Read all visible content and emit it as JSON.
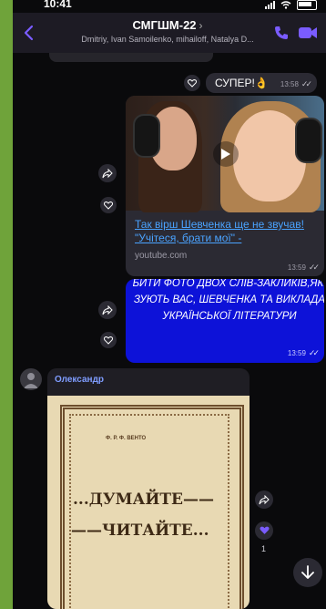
{
  "header": {
    "title": "СМГШМ-22",
    "chevron": "›",
    "subtitle": "Dmitriy, Ivan Samoilenko, mihailoff, Natalya D..."
  },
  "messages": [
    {
      "text": "СУПЕР!👌",
      "time": "13:58"
    },
    {
      "link_title": "Так вірш Шевченка ще не звучав! \"Учітеся, брати мої\" -",
      "link_domain": "youtube.com",
      "time": "13:59"
    },
    {
      "lines": [
        "БИТИ ФОТО ДВОХ СЛІВ-ЗАКЛИКІВ,ЯКІ",
        "ЗУЮТЬ ВАС, ШЕВЧЕНКА ТА ВИКЛАДА",
        "УКРАЇНСЬКОЇ ЛІТЕРАТУРИ"
      ],
      "time": "13:59"
    },
    {
      "sender": "Олександр",
      "book_author": "Ф. Р. Ф. ВЕНТО",
      "book_line1": "...ДУМАЙТЕ——",
      "book_line2": "——ЧИТАЙТЕ...",
      "reaction_count": "1"
    }
  ],
  "colors": {
    "accent": "#7a5cff",
    "blue_bubble": "#0d12d8",
    "link": "#4aa3ff",
    "sender": "#7f9dff"
  },
  "icons": {
    "back": "chevron-left-icon",
    "call": "phone-icon",
    "video": "video-camera-icon",
    "share": "share-icon",
    "heart": "heart-icon",
    "play": "play-icon",
    "scroll": "arrow-down-icon"
  }
}
